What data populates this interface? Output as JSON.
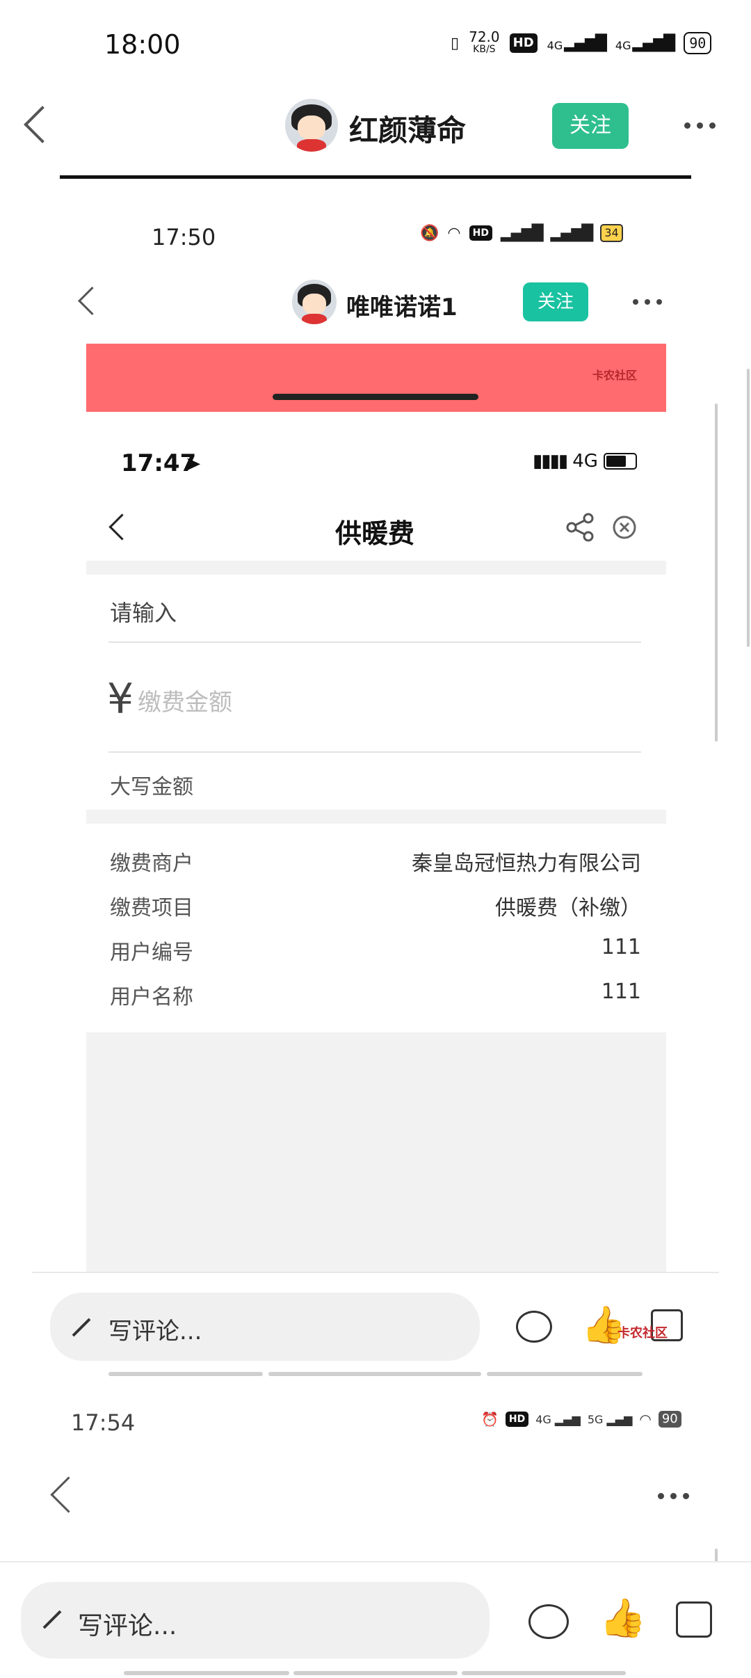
{
  "status_bar": {
    "time": "18:00",
    "speed_value": "72.0",
    "speed_unit": "KB/S",
    "hd_badge": "HD",
    "net1": "4G",
    "net2": "4G",
    "battery": "90"
  },
  "header": {
    "username": "红颜薄命",
    "follow_label": "关注"
  },
  "inner1": {
    "status_time": "17:50",
    "battery": "34",
    "username": "唯唯诺诺1",
    "follow_label": "关注",
    "watermark": "卡农社区"
  },
  "inner2": {
    "status_time": "17:47",
    "network": "4G",
    "page_title": "供暖费",
    "input_placeholder": "请输入",
    "currency_symbol": "¥",
    "amount_placeholder": "缴费金额",
    "uppercase_label": "大写金额",
    "rows": [
      {
        "label": "缴费商户",
        "value": "秦皇岛冠恒热力有限公司"
      },
      {
        "label": "缴费项目",
        "value": "供暖费（补缴）"
      },
      {
        "label": "用户编号",
        "value": "111"
      },
      {
        "label": "用户名称",
        "value": "111"
      }
    ]
  },
  "comment_bar_inner": {
    "placeholder": "写评论...",
    "watermark": "卡农社区"
  },
  "inner3": {
    "status_time": "17:54",
    "battery": "90",
    "net1": "4G",
    "net2": "5G"
  },
  "comment_bar_outer": {
    "placeholder": "写评论..."
  }
}
